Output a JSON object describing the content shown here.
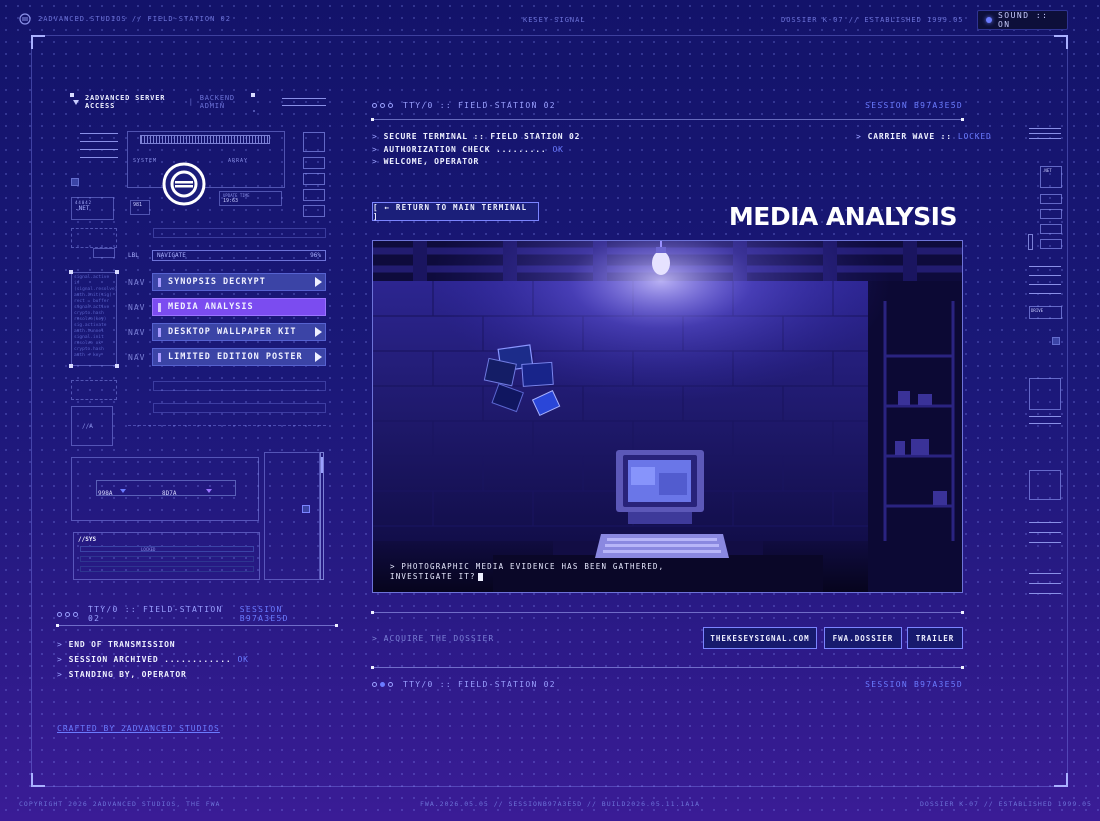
{
  "top_bar": {
    "left": "2ADVANCED.STUDIOS  //  FIELD-STATION 02",
    "center": "KESEY-SIGNAL",
    "right": "DOSSIER K-07  //  ESTABLISHED 1999.05",
    "sound": "SOUND :: ON"
  },
  "left_panel": {
    "title": "2ADVANCED SERVER ACCESS",
    "title_sub": "BACKEND ADMIN",
    "system_label": "SYSTEM",
    "array_label": "ARRAY",
    "net_label": ".NET",
    "clock": "19:63",
    "lbl": "LBL",
    "navigate": "NAVIGATE",
    "navigate_val": "96%",
    "nav_tag": "NAV",
    "nav_items": [
      {
        "label": "SYNOPSIS DECRYPT",
        "active": false
      },
      {
        "label": "MEDIA ANALYSIS",
        "active": true
      },
      {
        "label": "DESKTOP WALLPAPER KIT",
        "active": false
      },
      {
        "label": "LIMITED EDITION POSTER",
        "active": false
      }
    ],
    "field_ids": [
      "998A",
      "8D7A"
    ],
    "sys_label": "//SYS",
    "sys_status": "LOCKED"
  },
  "left_terminal": {
    "tty": "TTY/0 :: FIELD-STATION 02",
    "session": "SESSION B97A3E5D",
    "lines": [
      {
        "text": "END OF TRANSMISSION",
        "status": ""
      },
      {
        "text": "SESSION ARCHIVED ............",
        "status": "OK"
      },
      {
        "text": "STANDING BY, OPERATOR",
        "status": ""
      }
    ],
    "credit": "CRAFTED BY 2ADVANCED STUDIOS"
  },
  "main": {
    "tty": "TTY/0 :: FIELD-STATION 02",
    "session": "SESSION B97A3E5D",
    "lines": [
      {
        "text": "SECURE TERMINAL :: FIELD STATION 02",
        "status": ""
      },
      {
        "text": "AUTHORIZATION CHECK .........",
        "status": "OK"
      },
      {
        "text": "WELCOME, OPERATOR",
        "status": ""
      }
    ],
    "carrier_label": "CARRIER WAVE ::",
    "carrier_status": "LOCKED",
    "return_button": "[ ← RETURN TO MAIN TERMINAL ]",
    "page_title": "MEDIA ANALYSIS",
    "caption_1": "> PHOTOGRAPHIC MEDIA EVIDENCE HAS BEEN GATHERED,",
    "caption_2": "INVESTIGATE IT?",
    "acquire": "> ACQUIRE THE DOSSIER",
    "links": [
      "THEKESEYSIGNAL.COM",
      "FWA.DOSSIER",
      "TRAILER"
    ],
    "footer_tty": "TTY/0 :: FIELD-STATION 02",
    "footer_session": "SESSION B97A3E5D"
  },
  "right_column": {
    "net": ".NET",
    "drive": "DRIVE"
  },
  "footer": {
    "left": "COPYRIGHT 2026 2ADVANCED STUDIOS, THE FWA",
    "center": "FWA.2026.05.05  //  SESSIONB97A3E5D  //  BUILD2026.05.11.1A1A",
    "right": "DOSSIER K-07  //  ESTABLISHED 1999.05"
  },
  "colors": {
    "accent": "#6b7bff",
    "active_nav": "#7b4cf0",
    "nav": "#3b44a6"
  }
}
